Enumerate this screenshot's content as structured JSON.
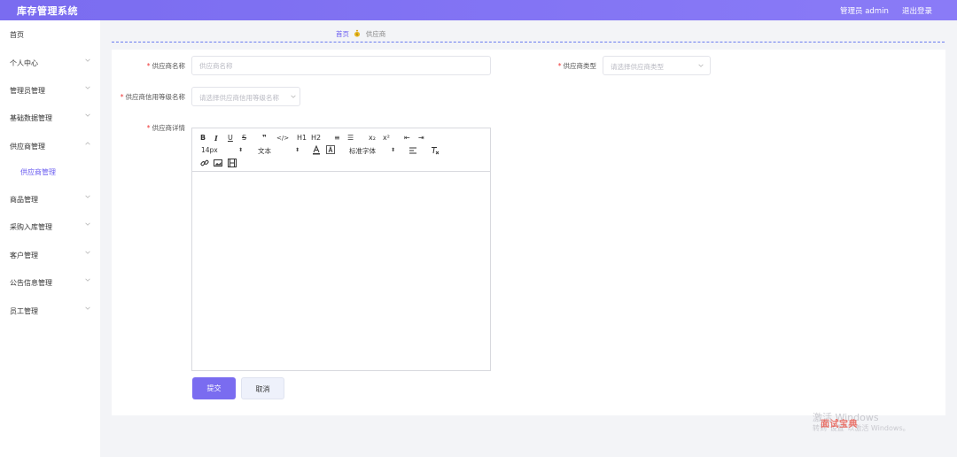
{
  "header": {
    "title": "库存管理系统",
    "user": "管理员 admin",
    "logout": "退出登录"
  },
  "sidebar": {
    "items": [
      {
        "label": "首页",
        "has_chevron": false
      },
      {
        "label": "个人中心",
        "has_chevron": true
      },
      {
        "label": "管理员管理",
        "has_chevron": true
      },
      {
        "label": "基础数据管理",
        "has_chevron": true
      },
      {
        "label": "供应商管理",
        "has_chevron": true,
        "expanded": true
      },
      {
        "label": "供应商管理",
        "sub": true,
        "active": true
      },
      {
        "label": "商品管理",
        "has_chevron": true
      },
      {
        "label": "采购入库管理",
        "has_chevron": true
      },
      {
        "label": "客户管理",
        "has_chevron": true
      },
      {
        "label": "公告信息管理",
        "has_chevron": true
      },
      {
        "label": "员工管理",
        "has_chevron": true
      }
    ]
  },
  "breadcrumb": {
    "home": "首页",
    "current": "供应商"
  },
  "form": {
    "name_label": "供应商名称",
    "name_placeholder": "供应商名称",
    "type_label": "供应商类型",
    "type_placeholder": "请选择供应商类型",
    "credit_label": "供应商信用等级名称",
    "credit_placeholder": "请选择供应商信用等级名称",
    "detail_label": "供应商详情",
    "required_mark": "*"
  },
  "editor": {
    "row1": [
      "B",
      "I",
      "U",
      "S",
      "❞",
      "</>",
      "H1",
      "H2",
      "≡",
      "☰",
      "x₂",
      "x²",
      "⇤",
      "⇥"
    ],
    "font_size": "14px",
    "paragraph": "文本",
    "font_family": "标准字体"
  },
  "buttons": {
    "submit": "提交",
    "cancel": "取消"
  },
  "watermark": {
    "line1": "激活 Windows",
    "line2": "转到\"设置\"以激活 Windows。",
    "stamp": "面试宝典"
  },
  "colors": {
    "accent": "#7a6cf0",
    "required": "#e33333",
    "active_menu": "#6a5cf0"
  }
}
